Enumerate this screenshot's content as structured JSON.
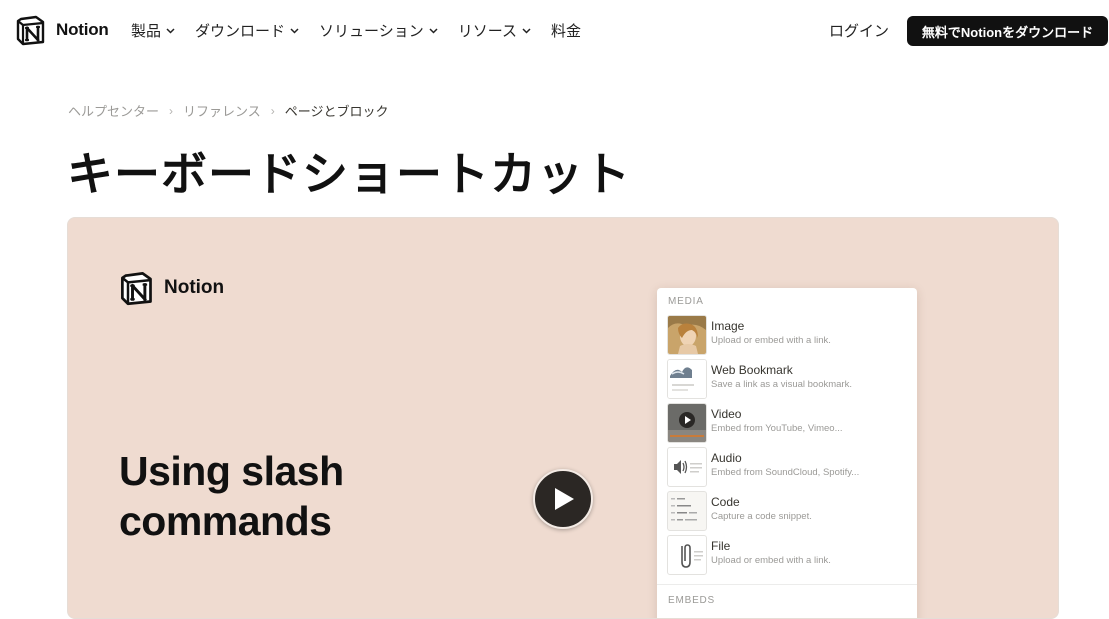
{
  "colors": {
    "background": "#ffffff",
    "text": "#111111",
    "button_bg": "#111111",
    "button_text": "#ffffff",
    "video_bg": "#efdbd0",
    "muted": "#9b9a97"
  },
  "nav": {
    "brand": "Notion",
    "items": [
      {
        "label": "製品",
        "dropdown": true
      },
      {
        "label": "ダウンロード",
        "dropdown": true
      },
      {
        "label": "ソリューション",
        "dropdown": true
      },
      {
        "label": "リソース",
        "dropdown": true
      },
      {
        "label": "料金",
        "dropdown": false
      }
    ],
    "login": "ログイン",
    "cta": "無料でNotionをダウンロード"
  },
  "breadcrumb": {
    "items": [
      "ヘルプセンター",
      "リファレンス",
      "ページとブロック"
    ],
    "separator": "›"
  },
  "page": {
    "title": "キーボードショートカット"
  },
  "video": {
    "brand": "Notion",
    "headline_line1": "Using slash",
    "headline_line2": "commands",
    "play_icon": "play-icon",
    "menu": {
      "section": "MEDIA",
      "next_section": "EMBEDS",
      "items": [
        {
          "title": "Image",
          "desc": "Upload or embed with a link.",
          "icon": "image-thumbnail"
        },
        {
          "title": "Web Bookmark",
          "desc": "Save a link as a visual bookmark.",
          "icon": "bookmark-thumbnail"
        },
        {
          "title": "Video",
          "desc": "Embed from YouTube, Vimeo...",
          "icon": "video-thumbnail"
        },
        {
          "title": "Audio",
          "desc": "Embed from SoundCloud, Spotify...",
          "icon": "audio-icon"
        },
        {
          "title": "Code",
          "desc": "Capture a code snippet.",
          "icon": "code-thumbnail"
        },
        {
          "title": "File",
          "desc": "Upload or embed with a link.",
          "icon": "file-icon"
        }
      ]
    }
  }
}
